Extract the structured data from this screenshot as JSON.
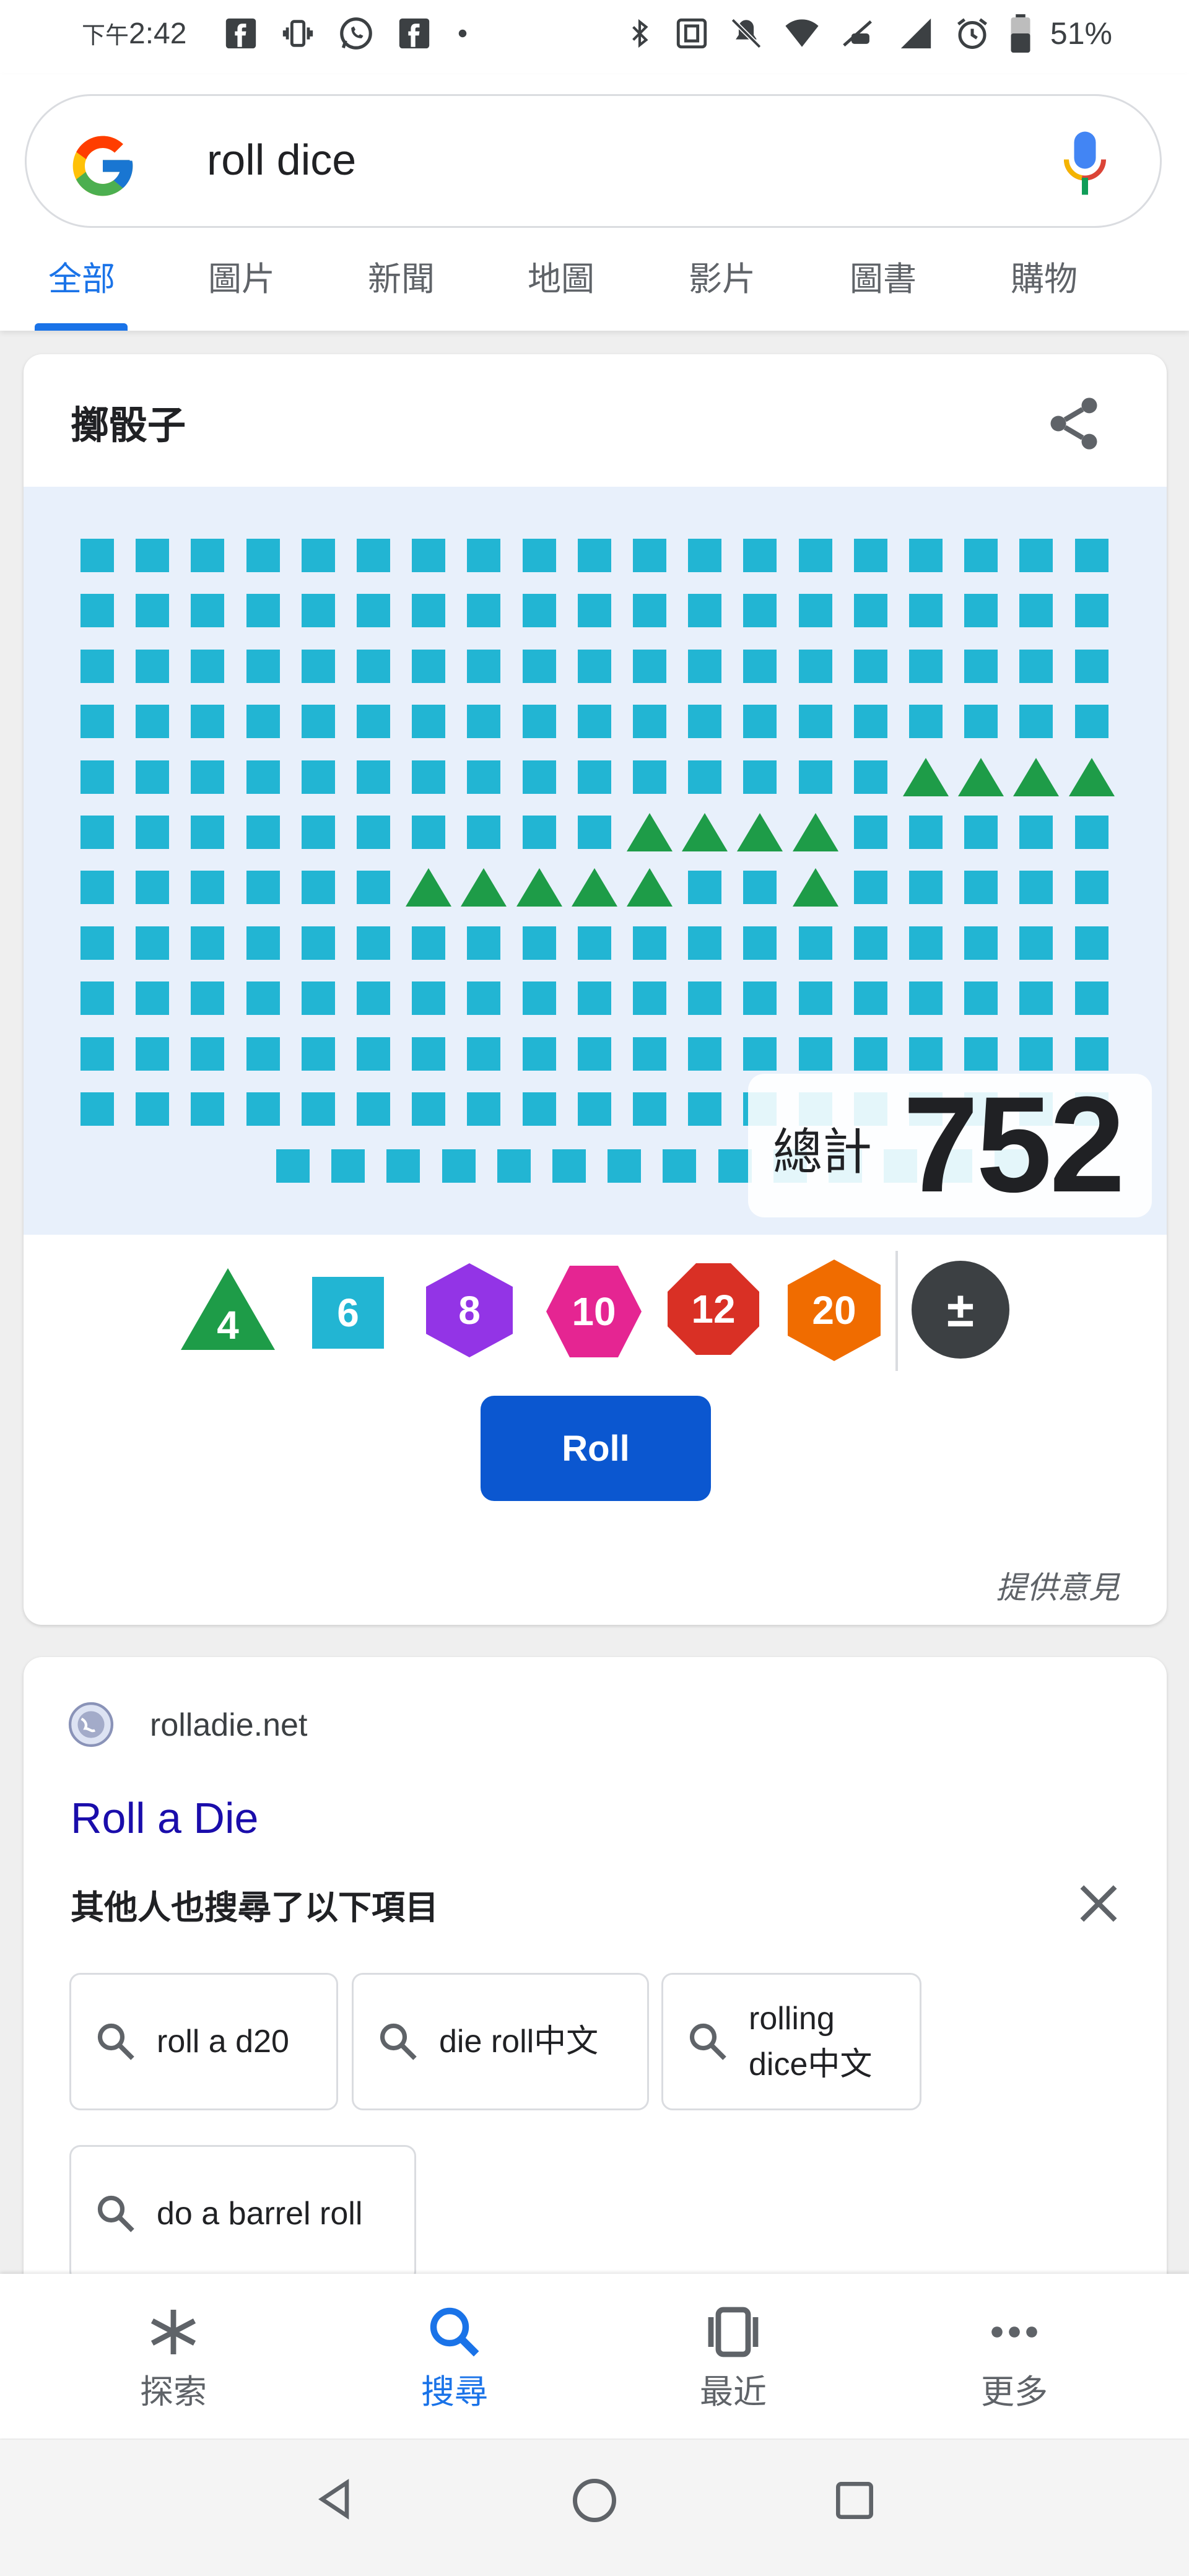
{
  "status_bar": {
    "time_prefix": "下午",
    "time": "2:42",
    "battery": "51%"
  },
  "search": {
    "query": "roll dice",
    "tabs": [
      "全部",
      "圖片",
      "新聞",
      "地圖",
      "影片",
      "圖書",
      "購物"
    ],
    "active_tab": "全部"
  },
  "dice_card": {
    "title": "擲骰子",
    "total_label": "總計",
    "total_value": "752",
    "rolled_dice": {
      "d6_count": 209,
      "d4_count": 14
    },
    "dice_options": [
      {
        "label": "4",
        "shape": "triangle",
        "color": "#1e9c48"
      },
      {
        "label": "6",
        "shape": "square",
        "color": "#22b5d3"
      },
      {
        "label": "8",
        "shape": "hexagon",
        "color": "#9334e6"
      },
      {
        "label": "10",
        "shape": "hexagon",
        "color": "#e52592"
      },
      {
        "label": "12",
        "shape": "octagon",
        "color": "#d93025"
      },
      {
        "label": "20",
        "shape": "hexagon",
        "color": "#f06c00"
      },
      {
        "label": "±",
        "shape": "circle",
        "color": "#3c4043"
      }
    ],
    "roll_button": "Roll",
    "feedback": "提供意見"
  },
  "result": {
    "site": "rolladie.net",
    "title": "Roll a Die",
    "people_also_search_title": "其他人也搜尋了以下項目",
    "suggestions": [
      "roll a d20",
      "die roll中文",
      "rolling dice中文",
      "do a barrel roll"
    ]
  },
  "bottom_nav": {
    "items": [
      "探索",
      "搜尋",
      "最近",
      "更多"
    ],
    "active": "搜尋"
  },
  "colors": {
    "accent": "#1a73e8",
    "roll_button": "#0b57d0",
    "d6": "#22b5d3",
    "d4": "#1e9c48"
  }
}
